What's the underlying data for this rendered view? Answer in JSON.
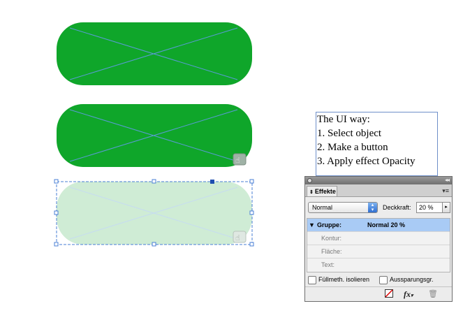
{
  "text_frame": {
    "lines": [
      "The UI way:",
      "1. Select object",
      "2. Make a button",
      "3. Apply effect Opacity"
    ]
  },
  "colors": {
    "button_green": "#0fa62a",
    "button_faded": "#cfecd5",
    "frame_blue": "#4a7fd6",
    "selection": "#1f5fe0"
  },
  "panel": {
    "tab_label": "Effekte",
    "blend_mode": "Normal",
    "opacity_label": "Deckkraft:",
    "opacity_value": "20 %",
    "rows": [
      {
        "label": "Gruppe:",
        "value": "Normal 20 %"
      },
      {
        "label": "Kontur:",
        "value": ""
      },
      {
        "label": "Fläche:",
        "value": ""
      },
      {
        "label": "Text:",
        "value": ""
      }
    ],
    "isolate_label": "Füllmeth. isolieren",
    "knockout_label": "Aussparungsgr.",
    "icons": [
      "clear-effects-icon",
      "fx-icon",
      "trash-icon"
    ]
  }
}
